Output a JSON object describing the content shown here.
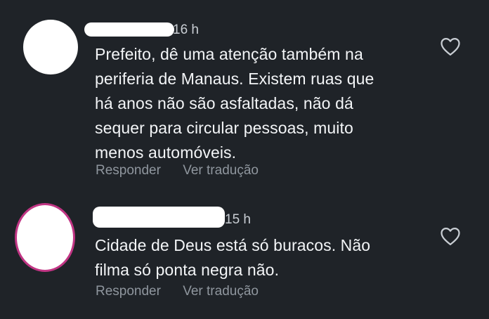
{
  "comments": [
    {
      "time": "16 h",
      "lines": [
        "Prefeito, dê uma atenção também na",
        "periferia de Manaus. Existem ruas que",
        "há anos não são asfaltadas, não dá",
        "sequer para circular pessoas, muito",
        "menos automóveis."
      ],
      "reply_label": "Responder",
      "translate_label": "Ver tradução",
      "like_icon": "heart-outline-icon"
    },
    {
      "time": "15 h",
      "lines": [
        "Cidade de Deus está só buracos. Não",
        "filma só ponta negra não."
      ],
      "reply_label": "Responder",
      "translate_label": "Ver tradução",
      "like_icon": "heart-outline-icon"
    }
  ],
  "colors": {
    "background": "#1f2328",
    "text": "#f3f5f7",
    "muted": "#8f969e",
    "story_ring": "#c13584"
  }
}
